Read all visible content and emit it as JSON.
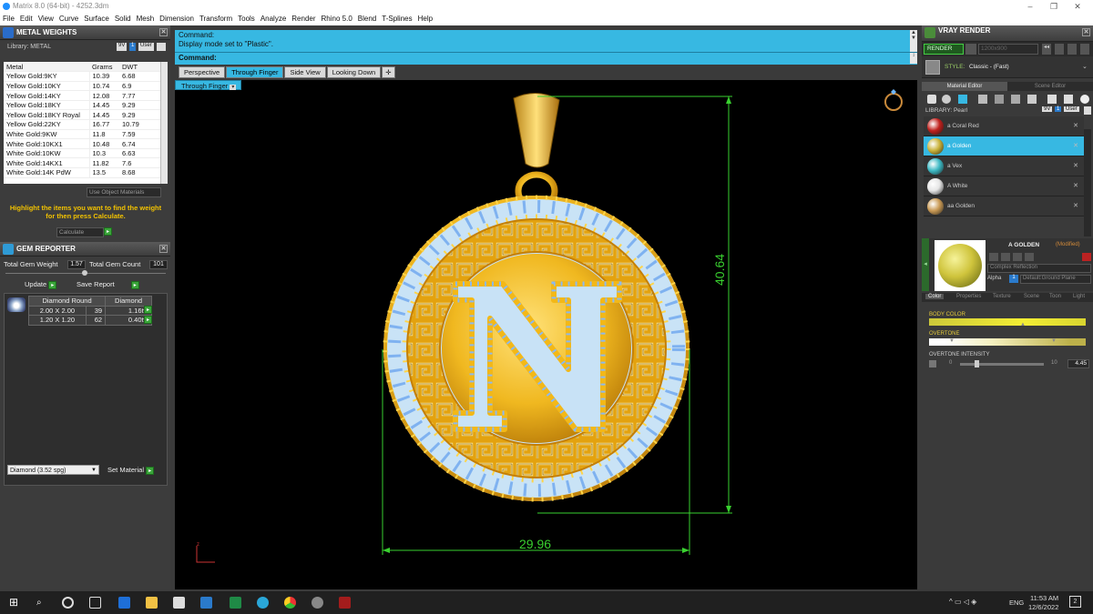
{
  "window": {
    "title": "Matrix 8.0 (64-bit) - 4252.3dm"
  },
  "menu": [
    "File",
    "Edit",
    "View",
    "Curve",
    "Surface",
    "Solid",
    "Mesh",
    "Dimension",
    "Transform",
    "Tools",
    "Analyze",
    "Render",
    "Rhino 5.0",
    "Blend",
    "T-Splines",
    "Help"
  ],
  "metal_weights": {
    "title": "METAL WEIGHTS",
    "library_label": "Library: METAL",
    "buttons": {
      "9v": "9V",
      "one": "1",
      "user": "User"
    },
    "columns": [
      "Metal",
      "Grams",
      "DWT"
    ],
    "rows": [
      [
        "Yellow Gold:9KY",
        "10.39",
        "6.68"
      ],
      [
        "Yellow Gold:10KY",
        "10.74",
        "6.9"
      ],
      [
        "Yellow Gold:14KY",
        "12.08",
        "7.77"
      ],
      [
        "Yellow Gold:18KY",
        "14.45",
        "9.29"
      ],
      [
        "Yellow Gold:18KY Royal",
        "14.45",
        "9.29"
      ],
      [
        "Yellow Gold:22KY",
        "16.77",
        "10.79"
      ],
      [
        "White Gold:9KW",
        "11.8",
        "7.59"
      ],
      [
        "White Gold:10KX1",
        "10.48",
        "6.74"
      ],
      [
        "White Gold:10KW",
        "10.3",
        "6.63"
      ],
      [
        "White Gold:14KX1",
        "11.82",
        "7.6"
      ],
      [
        "White Gold:14K PdW",
        "13.5",
        "8.68"
      ]
    ],
    "use_object_materials": "Use Object Materials",
    "hint": "Highlight the items you want to find the weight for then press Calculate.",
    "calculate": "Calculate"
  },
  "gem_reporter": {
    "title": "GEM REPORTER",
    "total_weight_label": "Total Gem Weight",
    "total_weight": "1.57",
    "total_count_label": "Total Gem Count",
    "total_count": "101",
    "update": "Update",
    "save_report": "Save Report",
    "columns": [
      "Diamond Round",
      "Diamond"
    ],
    "rows": [
      [
        "2.00 X 2.00",
        "39",
        "1.16tw"
      ],
      [
        "1.20 X 1.20",
        "62",
        "0.40tw"
      ]
    ],
    "material_select": "Diamond     (3.52 spg)",
    "set_material": "Set Material"
  },
  "command": {
    "line1": "Command:",
    "line2": "Display mode set to \"Plastic\".",
    "prompt": "Command:"
  },
  "viewport_tabs": [
    "Perspective",
    "Through Finger",
    "Side View",
    "Looking Down"
  ],
  "active_tab": "Through Finger",
  "viewport_label": "Through Finger",
  "dimensions": {
    "height": "40.64",
    "width": "29.96"
  },
  "vray": {
    "title": "VRAY RENDER",
    "render_button": "RENDER",
    "resolution": "1200x900",
    "style_label": "STYLE:",
    "style_value": "Classic - (Fast)",
    "tabs": [
      "Material Editor",
      "Scene Editor"
    ],
    "library_label": "LIBRARY: Pearl",
    "materials": [
      {
        "name": "a Coral Red",
        "color": "#c0211d"
      },
      {
        "name": "a Golden",
        "color": "#c9b23a"
      },
      {
        "name": "a Vex",
        "color": "#3db9c4"
      },
      {
        "name": "A White",
        "color": "#e5e5e5"
      },
      {
        "name": "aa  Golden",
        "color": "#c99a55"
      }
    ],
    "selected_material": "a Golden",
    "preview_title": "A GOLDEN",
    "preview_modified": "(Modified)",
    "complex_reflection": "Complex Reflection",
    "alpha_label": "Alpha",
    "alpha_value": "1",
    "ground_plane": "Default:Ground Plane",
    "prop_tabs": [
      "Color",
      "Properties",
      "Texture",
      "Scene",
      "Toon",
      "Light"
    ],
    "body_color_label": "BODY COLOR",
    "overtone_label": "OVERTONE",
    "overtone_intensity_label": "OVERTONE INTENSITY",
    "intensity_min": "0",
    "intensity_max": "10",
    "intensity_value": "4.45"
  },
  "taskbar": {
    "lang": "ENG",
    "time": "11:53 AM",
    "date": "12/6/2022",
    "notifications": "2"
  }
}
